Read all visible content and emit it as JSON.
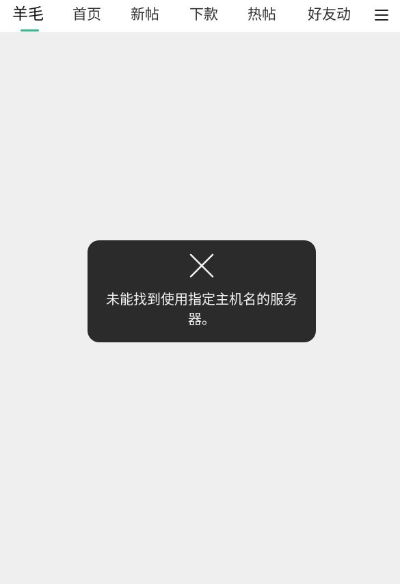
{
  "top_nav": {
    "tabs": [
      {
        "label": "羊毛",
        "active": true
      },
      {
        "label": "首页",
        "active": false
      },
      {
        "label": "新帖",
        "active": false
      },
      {
        "label": "下款",
        "active": false
      },
      {
        "label": "热帖",
        "active": false
      },
      {
        "label": "好友动",
        "active": false
      }
    ],
    "menu_icon": "hamburger-menu-icon",
    "active_color": "#31b98f"
  },
  "toast": {
    "icon": "close-icon",
    "message": "未能找到使用指定主机名的服务器。"
  }
}
